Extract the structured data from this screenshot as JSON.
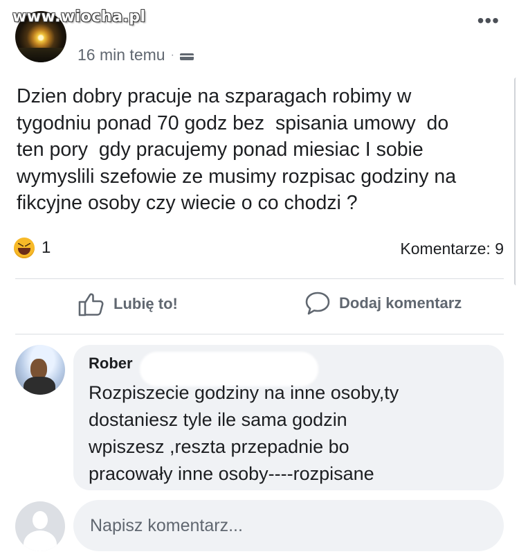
{
  "watermark": "www.wiocha.pl",
  "post": {
    "time": "16 min temu",
    "separator": "·",
    "body": "Dzien dobry pracuje na szparagach robimy w\ntygodniu ponad 70 godz bez  spisania umowy  do\nten pory  gdy pracujemy ponad miesiac I sobie\nwymyslili szefowie ze musimy rozpisac godziny na\nfikcyjne osoby czy wiecie o co chodzi ?",
    "reaction_icon": "haha-icon",
    "reaction_count": "1",
    "comments_count": "Komentarze: 9"
  },
  "actions": {
    "like_label": "Lubię to!",
    "comment_label": "Dodaj komentarz"
  },
  "comment": {
    "author": "Rober",
    "text": "Rozpiszecie godziny na inne osoby,ty\ndostaniesz tyle ile sama godzin\nwpiszesz ,reszta przepadnie bo\npracowały inne osoby----rozpisane"
  },
  "composer": {
    "placeholder": "Napisz komentarz..."
  },
  "colors": {
    "text": "#1c1e21",
    "secondary_text": "#606770",
    "bubble": "#f0f2f5",
    "divider": "#dadde1"
  }
}
